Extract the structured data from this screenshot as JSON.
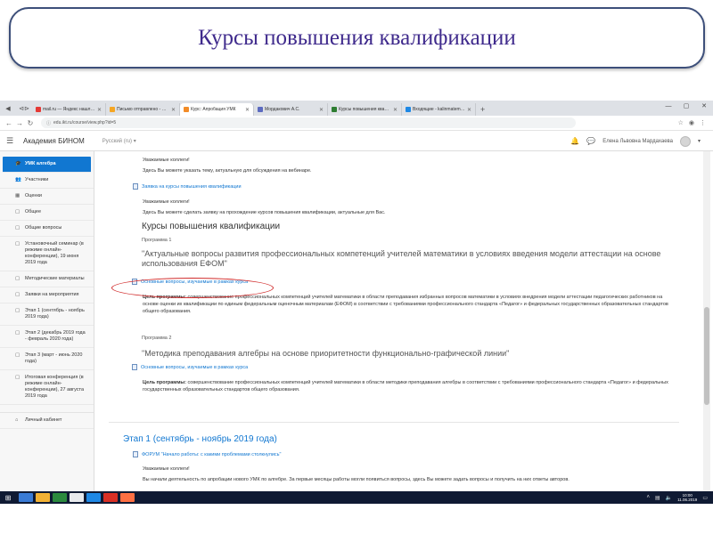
{
  "slide": {
    "title": "Курсы повышения квалификации"
  },
  "browser": {
    "tabs": [
      {
        "label": "mail.ru — Яндекс нашлось",
        "color": "#e53935",
        "active": false
      },
      {
        "label": "Письмо отправлено - Поч",
        "color": "#f5a623",
        "active": false
      },
      {
        "label": "Курс: Апробация УМК",
        "color": "#f28c28",
        "active": true
      },
      {
        "label": "Мордакович А.С.",
        "color": "#5c6bc0",
        "active": false
      },
      {
        "label": "Курсы повышения квалиф",
        "color": "#2e7d32",
        "active": false
      },
      {
        "label": "Входящие - kalinmatematika",
        "color": "#1e88e5",
        "active": false
      }
    ],
    "url": "edu.ikt.ru/course/view.php?id=5"
  },
  "moodle": {
    "site_name": "Академия БИНОМ",
    "language": "Русский (ru) ▾",
    "user_name": "Елена Львовна Мардахаева"
  },
  "drawer": {
    "items": [
      {
        "icon": "🎓",
        "label": "УМК алгебра",
        "active": true
      },
      {
        "icon": "👥",
        "label": "Участники"
      },
      {
        "icon": "▦",
        "label": "Оценки"
      },
      {
        "icon": "▢",
        "label": "Общее"
      },
      {
        "icon": "▢",
        "label": "Общие вопросы"
      },
      {
        "icon": "▢",
        "label": "Установочный семинар (в режиме онлайн-конференции), 19 июня 2019 года"
      },
      {
        "icon": "▢",
        "label": "Методические материалы"
      },
      {
        "icon": "▢",
        "label": "Заявки на мероприятия"
      },
      {
        "icon": "▢",
        "label": "Этап 1 (сентябрь - ноябрь 2019 года)"
      },
      {
        "icon": "▢",
        "label": "Этап 2 (декабрь 2019 года - февраль 2020 года)"
      },
      {
        "icon": "▢",
        "label": "Этап 3 (март - июнь 2020 года)"
      },
      {
        "icon": "▢",
        "label": "Итоговая конференция (в режиме онлайн-конференции), 27 августа 2019 года"
      }
    ],
    "bottom_item": {
      "icon": "⌂",
      "label": "Личный кабинет"
    }
  },
  "content": {
    "greeting1": "Уважаемые коллеги!",
    "note1": "Здесь Вы можете указать тему, актуальную для обсуждения на вебинаре.",
    "apply_link": "Заявка на курсы повышения квалификации",
    "greeting2": "Уважаемые коллеги!",
    "note2": "Здесь Вы можете сделать заявку на прохождение курсов повышения квалификации, актуальные для Вас.",
    "courses_heading": "Курсы повышения квалификации",
    "program1": {
      "label": "Программа 1",
      "title": "\"Актуальные вопросы развития профессиональных компетенций учителей математики в условиях введения модели аттестации на основе использования ЕФОМ\"",
      "link": "Основные вопросы, изучаемые в рамках курса",
      "goal_label": "Цель программы:",
      "goal_text": "совершенствование профессиональных компетенций учителей математики в области преподавания избранных вопросов математики в условиях внедрения модели аттестации педагогических работников на основе оценки их квалификации по единым федеральным оценочным материалам (ЕФОМ) в соответствии с требованиями профессионального стандарта «Педагог» и федеральных государственных образовательных стандартов общего образования."
    },
    "program2": {
      "label": "Программа 2",
      "title": "\"Методика преподавания алгебры на основе приоритетности функционально-графической линии\"",
      "link": "Основные вопросы, изучаемые в рамках курса",
      "goal_label": "Цель программы:",
      "goal_text": "совершенствование профессиональных компетенций учителей математики в области методики преподавания алгебры в соответствии с требованиями профессионального стандарта «Педагог» и федеральных государственных образовательных стандартов общего образования."
    },
    "stage1_title": "Этап 1 (сентябрь - ноябрь 2019 года)",
    "forum_link": "ФОРУМ \"Начало работы: с какими проблемами столкнулись\"",
    "greeting3": "Уважаемые коллеги!",
    "note3": "Вы начали деятельность по апробации нового УМК по алгебре. За первые месяцы работы могли появиться вопросы, здесь Вы можете задать вопросы и получить на них ответы авторов."
  },
  "taskbar": {
    "apps": [
      "#3a7bd5",
      "#f2b134",
      "#2b8a3e",
      "#e8eaed",
      "#1e88e5",
      "#d93025",
      "#ff7043"
    ],
    "time": "10:00",
    "date": "11.06.2019"
  }
}
